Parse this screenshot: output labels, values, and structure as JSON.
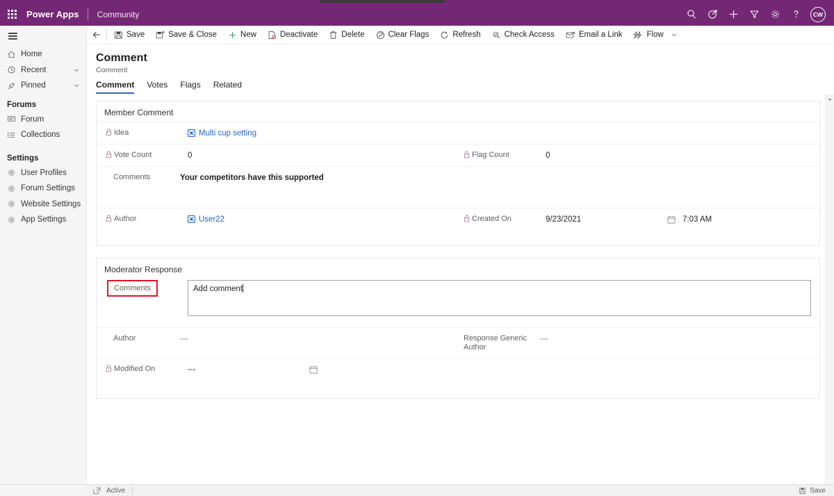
{
  "header": {
    "waffle_label": "app-launcher",
    "brand": "Power Apps",
    "environment": "Community",
    "icons": [
      {
        "name": "search-icon",
        "label": "Search"
      },
      {
        "name": "target-icon",
        "label": "Assistant"
      },
      {
        "name": "plus-icon",
        "label": "New"
      },
      {
        "name": "filter-icon",
        "label": "Filter"
      },
      {
        "name": "gear-icon",
        "label": "Settings"
      },
      {
        "name": "help-icon",
        "label": "Help"
      }
    ],
    "avatar_initials": "CW"
  },
  "sidebar": {
    "toggle_label": "Expand/Collapse site map",
    "items": [
      {
        "label": "Home",
        "icon": "home-icon",
        "chevron": false
      },
      {
        "label": "Recent",
        "icon": "clock-icon",
        "chevron": true
      },
      {
        "label": "Pinned",
        "icon": "pin-icon",
        "chevron": true
      }
    ],
    "groups": [
      {
        "title": "Forums",
        "items": [
          {
            "label": "Forum",
            "icon": "forum-icon"
          },
          {
            "label": "Collections",
            "icon": "list-icon"
          }
        ]
      },
      {
        "title": "Settings",
        "items": [
          {
            "label": "User Profiles",
            "icon": "gear-icon"
          },
          {
            "label": "Forum Settings",
            "icon": "gear-icon"
          },
          {
            "label": "Website Settings",
            "icon": "gear-icon"
          },
          {
            "label": "App Settings",
            "icon": "gear-icon"
          }
        ]
      }
    ]
  },
  "commandbar": {
    "back_label": "Back",
    "buttons": [
      {
        "label": "Save",
        "icon": "save-icon"
      },
      {
        "label": "Save & Close",
        "icon": "save-close-icon"
      },
      {
        "label": "New",
        "icon": "plus-icon"
      },
      {
        "label": "Deactivate",
        "icon": "deactivate-icon"
      },
      {
        "label": "Delete",
        "icon": "trash-icon"
      },
      {
        "label": "Clear Flags",
        "icon": "clear-flags-icon"
      },
      {
        "label": "Refresh",
        "icon": "refresh-icon"
      },
      {
        "label": "Check Access",
        "icon": "check-access-icon"
      },
      {
        "label": "Email a Link",
        "icon": "email-link-icon"
      },
      {
        "label": "Flow",
        "icon": "flow-icon"
      }
    ],
    "overflow_label": "More commands"
  },
  "record": {
    "title": "Comment",
    "subtitle": "Comment"
  },
  "tabs": [
    {
      "label": "Comment",
      "active": true
    },
    {
      "label": "Votes",
      "active": false
    },
    {
      "label": "Flags",
      "active": false
    },
    {
      "label": "Related",
      "active": false
    }
  ],
  "member_comment": {
    "section_title": "Member Comment",
    "idea": {
      "label": "Idea",
      "value": "Multi cup setting",
      "locked": true,
      "is_link": true
    },
    "vote_count": {
      "label": "Vote Count",
      "value": "0",
      "locked": true
    },
    "flag_count": {
      "label": "Flag Count",
      "value": "0",
      "locked": true
    },
    "comments": {
      "label": "Comments",
      "value": "Your competitors have this supported",
      "locked": false
    },
    "author": {
      "label": "Author",
      "value": "User22",
      "locked": true,
      "is_link": true
    },
    "created_on": {
      "label": "Created On",
      "date": "9/23/2021",
      "time": "7:03 AM",
      "locked": true
    }
  },
  "moderator_response": {
    "section_title": "Moderator Response",
    "comments": {
      "label": "Comments",
      "value": "Add comment",
      "highlighted": true
    },
    "author": {
      "label": "Author",
      "value": "---"
    },
    "response_generic_author": {
      "label": "Response Generic Author",
      "value": "---"
    },
    "modified_on": {
      "label": "Modified On",
      "value": "---",
      "locked": true
    }
  },
  "statusbar": {
    "state": "Active",
    "save_label": "Save",
    "expand_label": "open-in-new-window-icon"
  },
  "colors": {
    "brand_purple": "#742774",
    "tab_accent": "#3b5fc4",
    "link_blue": "#2266cc",
    "highlight_red": "#e81123",
    "sidebar_bg": "#f5f5f5"
  }
}
